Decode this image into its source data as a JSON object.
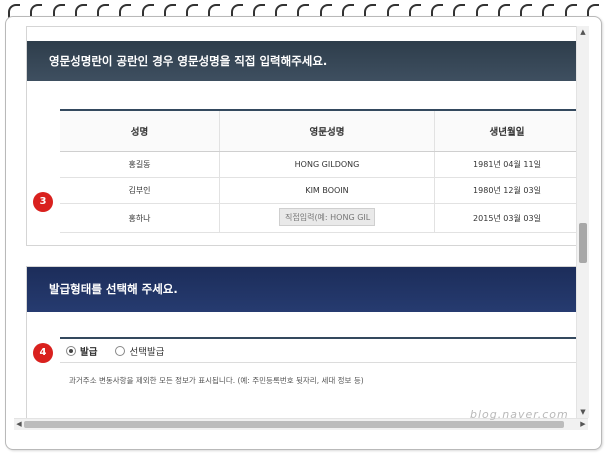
{
  "section1": {
    "banner": "영문성명란이 공란인 경우 영문성명을 직접 입력해주세요.",
    "step_badge": "3",
    "columns": [
      "성명",
      "영문성명",
      "생년월일"
    ],
    "rows": [
      {
        "name": "홍길동",
        "english": "HONG GILDONG",
        "birth": "1981년 04월 11일"
      },
      {
        "name": "김부인",
        "english": "KIM BOOIN",
        "birth": "1980년 12월 03일"
      },
      {
        "name": "홍하나",
        "english_placeholder": "직접입력(예: HONG GIL",
        "birth": "2015년 03월 03일"
      }
    ]
  },
  "section2": {
    "banner": "발급형태를 선택해 주세요.",
    "step_badge": "4",
    "options": [
      {
        "label": "발급",
        "selected": true
      },
      {
        "label": "선택발급",
        "selected": false
      }
    ],
    "note": "과거주소 변동사항을 제외한 모든 정보가 표시됩니다. (예: 주민등록번호 뒷자리, 세대 정보 등)"
  },
  "watermark": "blog.naver.com",
  "colors": {
    "banner1": "#34475a",
    "banner2": "#1f3265",
    "badge": "#d9211e"
  }
}
